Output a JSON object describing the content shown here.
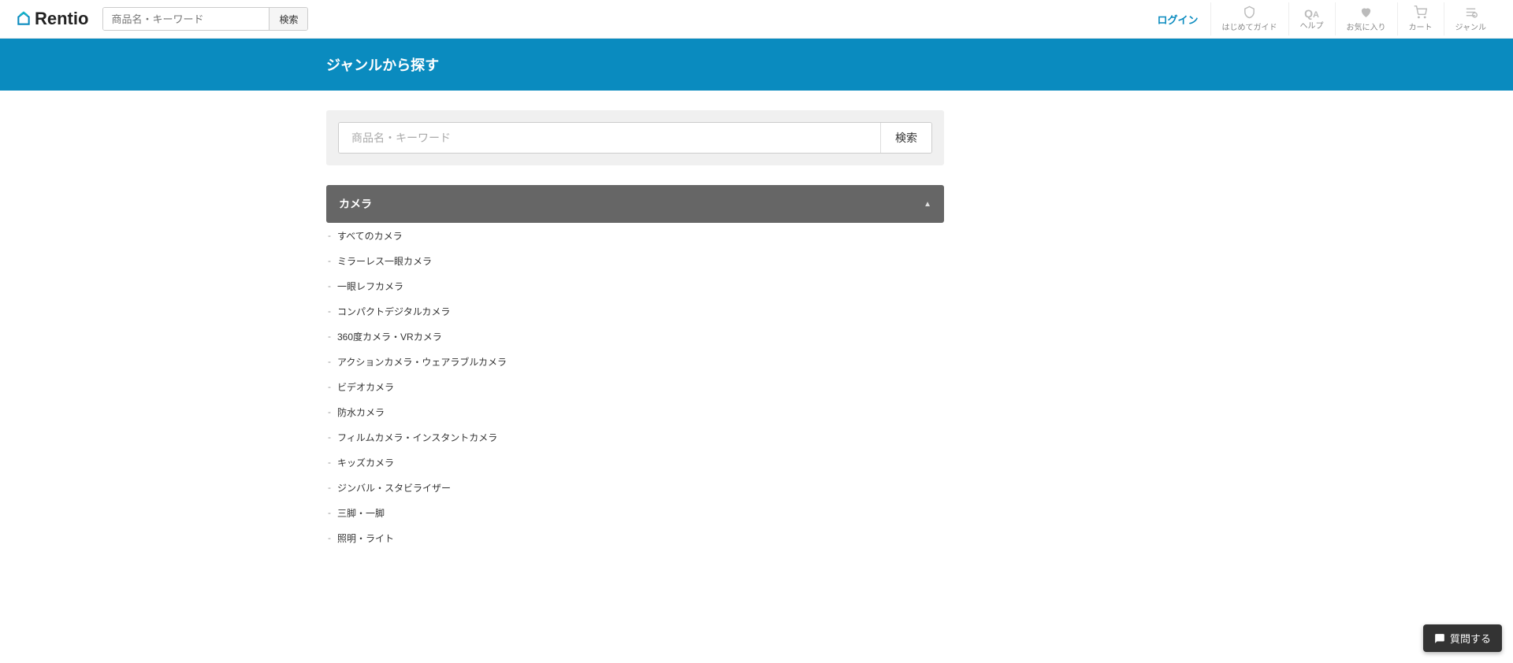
{
  "header": {
    "logo_text": "Rentio",
    "search_placeholder": "商品名・キーワード",
    "search_button": "検索",
    "login_label": "ログイン",
    "nav": [
      {
        "key": "guide",
        "icon": "shield",
        "label": "はじめてガイド"
      },
      {
        "key": "help",
        "icon": "qa",
        "label": "ヘルプ"
      },
      {
        "key": "favorite",
        "icon": "heart",
        "label": "お気に入り"
      },
      {
        "key": "cart",
        "icon": "cart",
        "label": "カート"
      },
      {
        "key": "genre",
        "icon": "genre",
        "label": "ジャンル"
      }
    ]
  },
  "band": {
    "title": "ジャンルから探す"
  },
  "main_search": {
    "placeholder": "商品名・キーワード",
    "button": "検索"
  },
  "category": {
    "title": "カメラ",
    "items": [
      "すべてのカメラ",
      "ミラーレス一眼カメラ",
      "一眼レフカメラ",
      "コンパクトデジタルカメラ",
      "360度カメラ・VRカメラ",
      "アクションカメラ・ウェアラブルカメラ",
      "ビデオカメラ",
      "防水カメラ",
      "フィルムカメラ・インスタントカメラ",
      "キッズカメラ",
      "ジンバル・スタビライザー",
      "三脚・一脚",
      "照明・ライト"
    ]
  },
  "chat": {
    "label": "質問する"
  }
}
